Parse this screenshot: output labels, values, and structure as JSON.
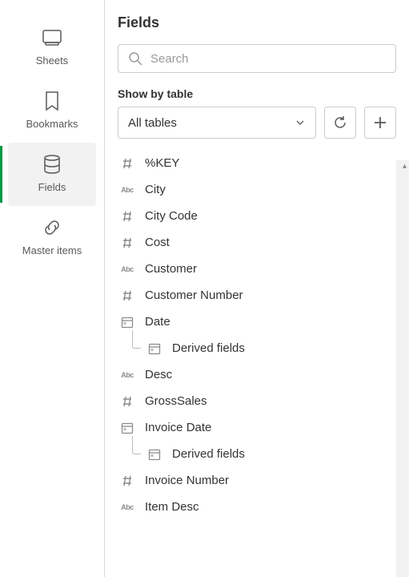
{
  "sidebar": {
    "items": [
      {
        "label": "Sheets"
      },
      {
        "label": "Bookmarks"
      },
      {
        "label": "Fields"
      },
      {
        "label": "Master items"
      }
    ]
  },
  "panel": {
    "title": "Fields",
    "search_placeholder": "Search",
    "show_by_label": "Show by table",
    "dropdown_value": "All tables"
  },
  "fields": [
    {
      "type": "number",
      "name": "%KEY"
    },
    {
      "type": "text",
      "name": "City"
    },
    {
      "type": "number",
      "name": "City Code"
    },
    {
      "type": "number",
      "name": "Cost"
    },
    {
      "type": "text",
      "name": "Customer"
    },
    {
      "type": "number",
      "name": "Customer Number"
    },
    {
      "type": "date",
      "name": "Date"
    },
    {
      "type": "date",
      "name": "Derived fields",
      "child": true
    },
    {
      "type": "text",
      "name": "Desc"
    },
    {
      "type": "number",
      "name": "GrossSales"
    },
    {
      "type": "date",
      "name": "Invoice Date"
    },
    {
      "type": "date",
      "name": "Derived fields",
      "child": true
    },
    {
      "type": "number",
      "name": "Invoice Number"
    },
    {
      "type": "text",
      "name": "Item Desc"
    }
  ]
}
